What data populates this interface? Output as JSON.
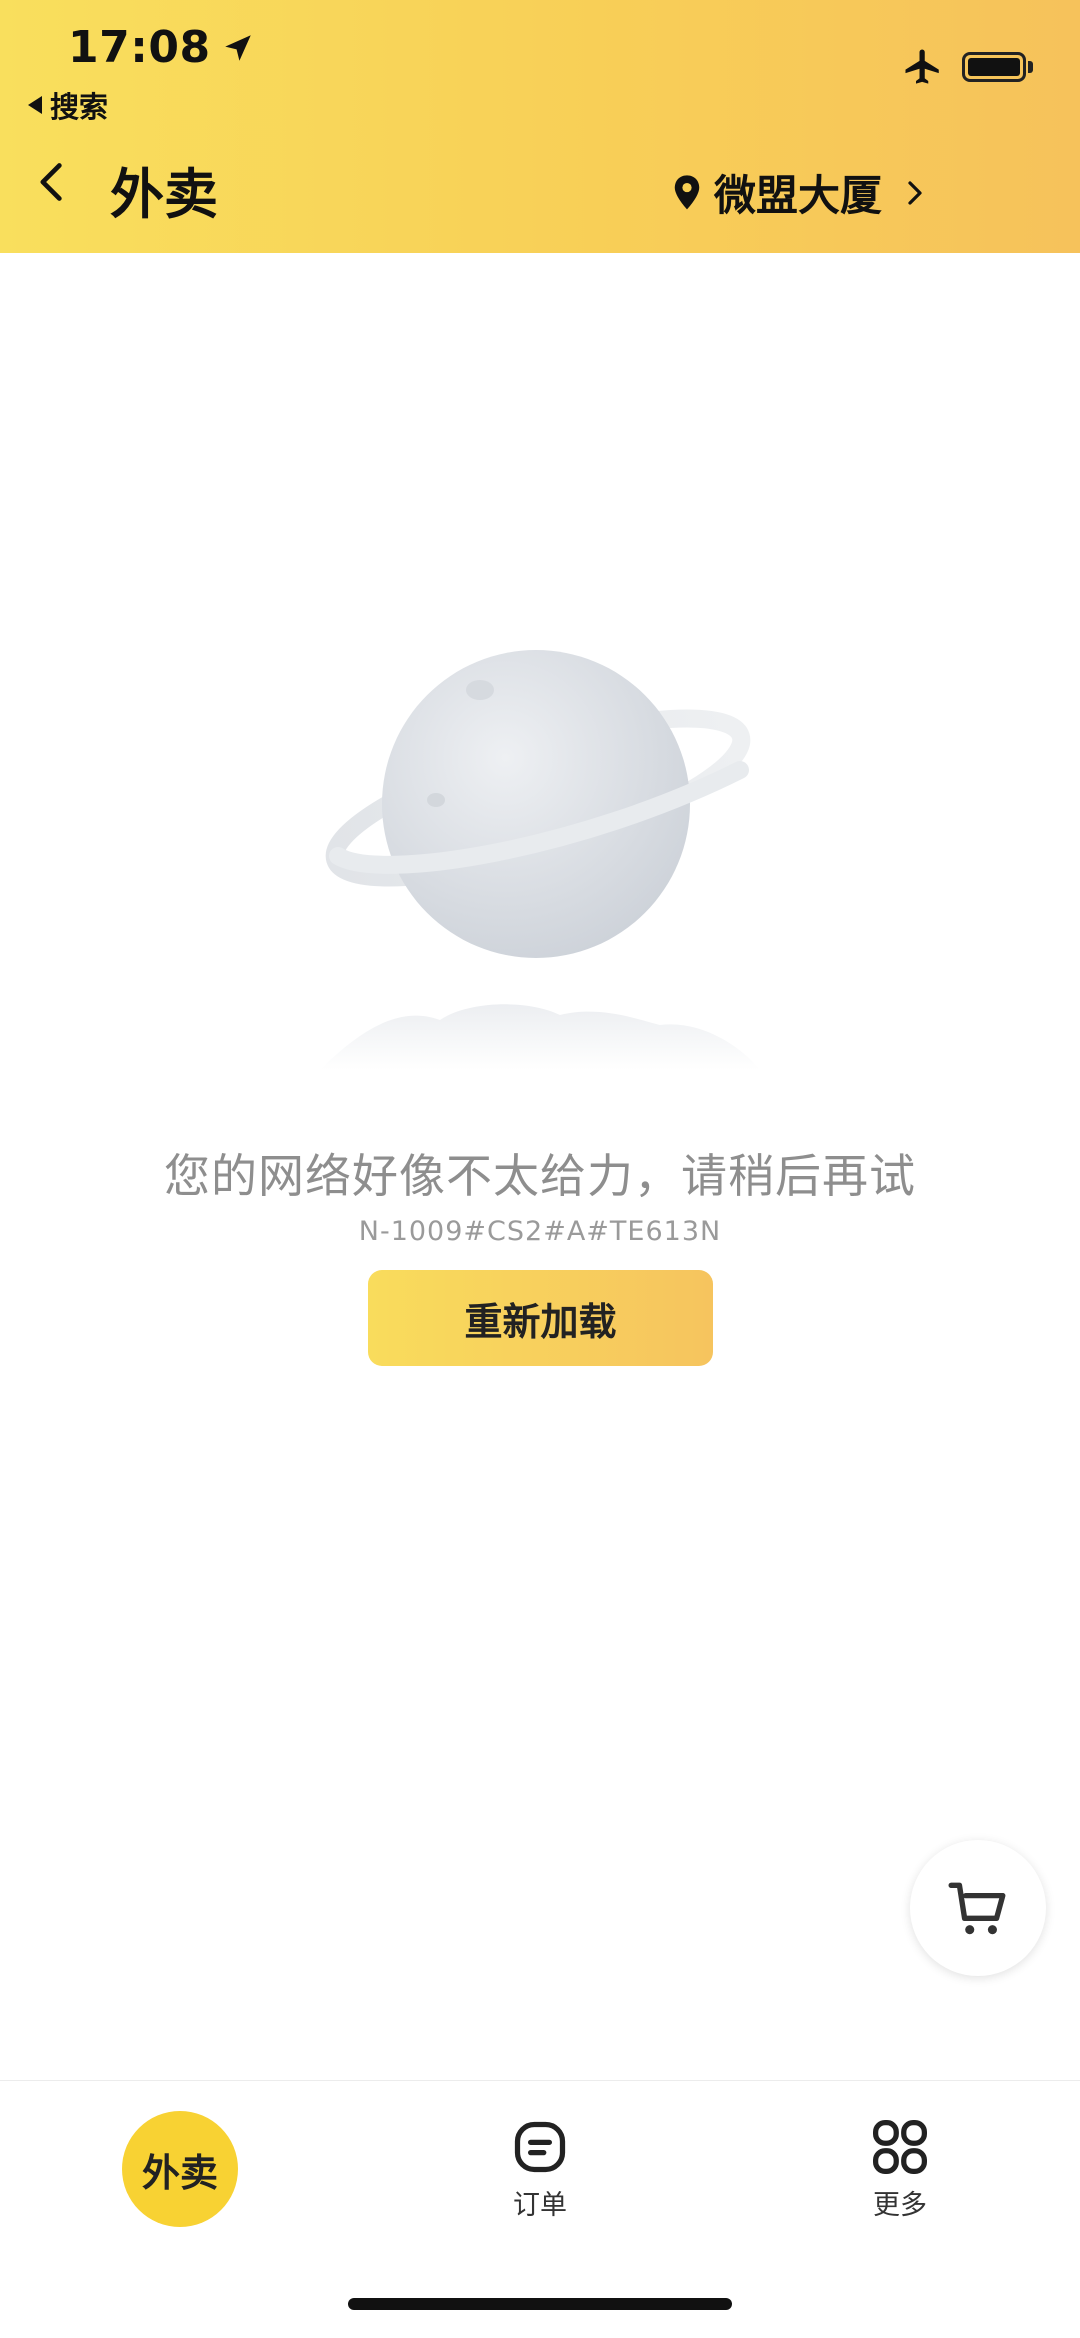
{
  "status_bar": {
    "time": "17:08",
    "back_app_label": "搜索"
  },
  "header": {
    "title": "外卖",
    "location": "微盟大厦",
    "accent_color": "#f8d54f"
  },
  "error": {
    "message": "您的网络好像不太给力，请稍后再试",
    "code": "N-1009#CS2#A#TE613N",
    "reload_label": "重新加载"
  },
  "cart": {
    "icon": "cart-icon"
  },
  "tabbar": {
    "home_label": "外卖",
    "orders_label": "订单",
    "more_label": "更多"
  }
}
